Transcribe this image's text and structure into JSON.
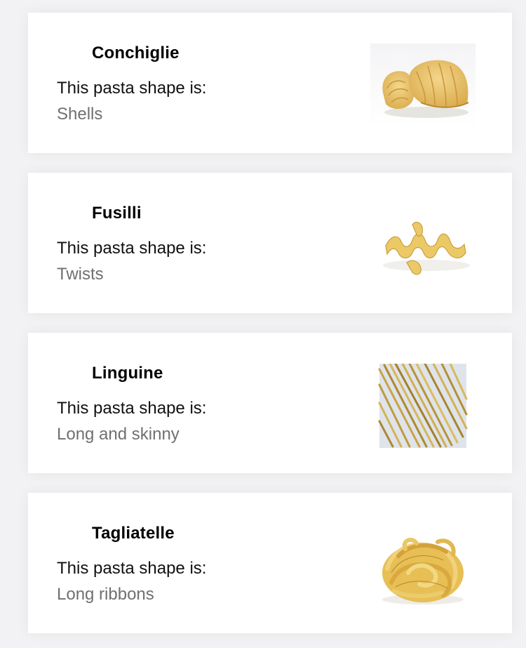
{
  "pastas": [
    {
      "name": "Conchiglie",
      "prefix": "This pasta shape is:",
      "shape": "Shells",
      "image": "conchiglie-photo"
    },
    {
      "name": "Fusilli",
      "prefix": "This pasta shape is:",
      "shape": "Twists",
      "image": "fusilli-photo"
    },
    {
      "name": "Linguine",
      "prefix": "This pasta shape is:",
      "shape": "Long and skinny",
      "image": "linguine-photo"
    },
    {
      "name": "Tagliatelle",
      "prefix": "This pasta shape is:",
      "shape": "Long ribbons",
      "image": "tagliatelle-photo"
    }
  ],
  "colors": {
    "background": "#f2f2f4",
    "card": "#ffffff",
    "name": "#000000",
    "prefix": "#111111",
    "shape": "#707070",
    "pasta": "#e8c46a"
  }
}
